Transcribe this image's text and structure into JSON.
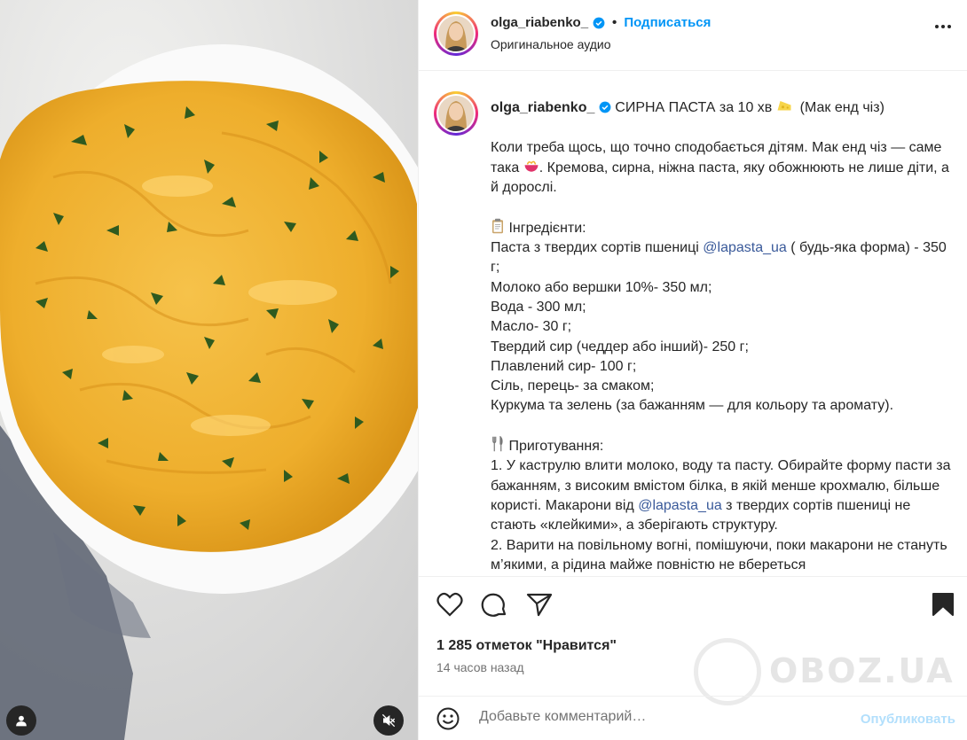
{
  "post": {
    "username": "olga_riabenko_",
    "separator": "•",
    "follow_label": "Подписаться",
    "audio_label": "Оригинальное аудио"
  },
  "caption": {
    "username": "olga_riabenko_",
    "title_pre": " СИРНА ПАСТА за 10 хв ",
    "title_post": "  (Мак енд чіз)",
    "p1_a": "Коли треба щось, що точно сподобається дітям. Мак енд чіз — саме така",
    "p1_b": ". Кремова, сирна, ніжна паста, яку обожнюють не лише діти, а й дорослі.",
    "ingr_title": " Інгредієнти:",
    "ingr_1a": "Паста з твердих сортів пшениці ",
    "mention": "@lapasta_ua",
    "ingr_1b": " ( будь-яка форма) - 350 г;",
    "ingr_2": "Молоко або вершки 10%- 350 мл;",
    "ingr_3": "Вода - 300 мл;",
    "ingr_4": "Масло- 30 г;",
    "ingr_5": "Твердий сир (чеддер або інший)- 250 г;",
    "ingr_6": "Плавлений сир- 100 г;",
    "ingr_7": "Сіль, перець- за смаком;",
    "ingr_8": "Куркума та зелень (за бажанням — для кольору та аромату).",
    "prep_title": " Приготування:",
    "prep_1a": "1. У каструлю влити молоко, воду та пасту. Обирайте форму пасти за бажанням, з високим вмістом білка, в якій менше крохмалю, більше користі. Макарони від ",
    "prep_1b": " з твердих сортів пшениці не стають «клейкими», а зберігають структуру.",
    "prep_2": "2. Варити на повільному вогні, помішуючи, поки макарони не стануть м’якими, а рідина майже повністю не вбереться"
  },
  "stats": {
    "likes": "1 285 отметок \"Нравится\"",
    "time": "14 часов назад"
  },
  "comment": {
    "placeholder": "Добавьте комментарий…",
    "publish_label": "Опубликовать"
  },
  "watermark": "OBOZ.UA",
  "colors": {
    "accent": "#0095f6",
    "mention": "#3a5a9a",
    "publish_disabled": "#b2dffc",
    "pasta": "#f2b331"
  },
  "icons": [
    "user-tag-icon",
    "mute-icon",
    "verified-icon",
    "more-icon",
    "heart-icon",
    "comment-icon",
    "share-icon",
    "bookmark-icon",
    "smile-icon"
  ]
}
